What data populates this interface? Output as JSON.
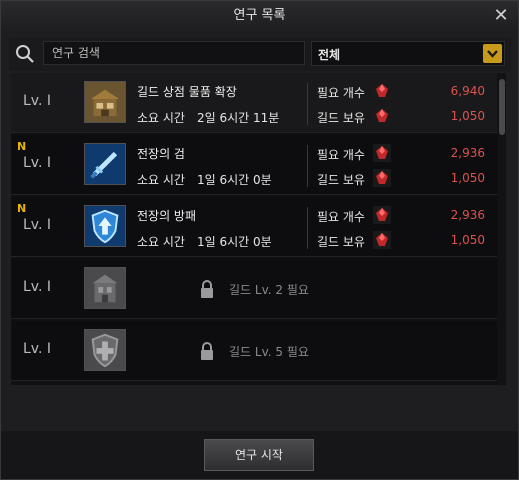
{
  "window": {
    "title": "연구 목록",
    "close_icon": "close-icon"
  },
  "search": {
    "placeholder": "연구 검색",
    "value": "",
    "icon": "search-icon"
  },
  "filter": {
    "selected": "전체",
    "accent_color": "#c89a1c"
  },
  "colors": {
    "cost_value": "#d9534f",
    "badge_new": "#e8b400"
  },
  "research_list": [
    {
      "level": "Lv. I",
      "is_new": false,
      "name": "길드 상점 물품 확장",
      "time_label": "소요 시간",
      "time_value": "2일 6시간 11분",
      "cost_required_label": "필요 개수",
      "cost_required": "6,940",
      "cost_owned_label": "길드 보유",
      "cost_owned": "1,050",
      "icon": "guild-shop-icon",
      "locked": false
    },
    {
      "level": "Lv. I",
      "is_new": true,
      "new_badge": "N",
      "name": "전장의 검",
      "time_label": "소요 시간",
      "time_value": "1일 6시간 0분",
      "cost_required_label": "필요 개수",
      "cost_required": "2,936",
      "cost_owned_label": "길드 보유",
      "cost_owned": "1,050",
      "icon": "sword-icon",
      "locked": false
    },
    {
      "level": "Lv. I",
      "is_new": true,
      "new_badge": "N",
      "name": "전장의 방패",
      "time_label": "소요 시간",
      "time_value": "1일 6시간 0분",
      "cost_required_label": "필요 개수",
      "cost_required": "2,936",
      "cost_owned_label": "길드 보유",
      "cost_owned": "1,050",
      "icon": "shield-arrow-icon",
      "locked": false
    },
    {
      "level": "Lv. I",
      "is_new": false,
      "locked": true,
      "lock_text": "길드 Lv. 2 필요",
      "icon": "building-icon"
    },
    {
      "level": "Lv. I",
      "is_new": false,
      "locked": true,
      "lock_text": "길드 Lv. 5 필요",
      "icon": "cross-shield-icon"
    }
  ],
  "footer": {
    "start_button": "연구 시작"
  }
}
